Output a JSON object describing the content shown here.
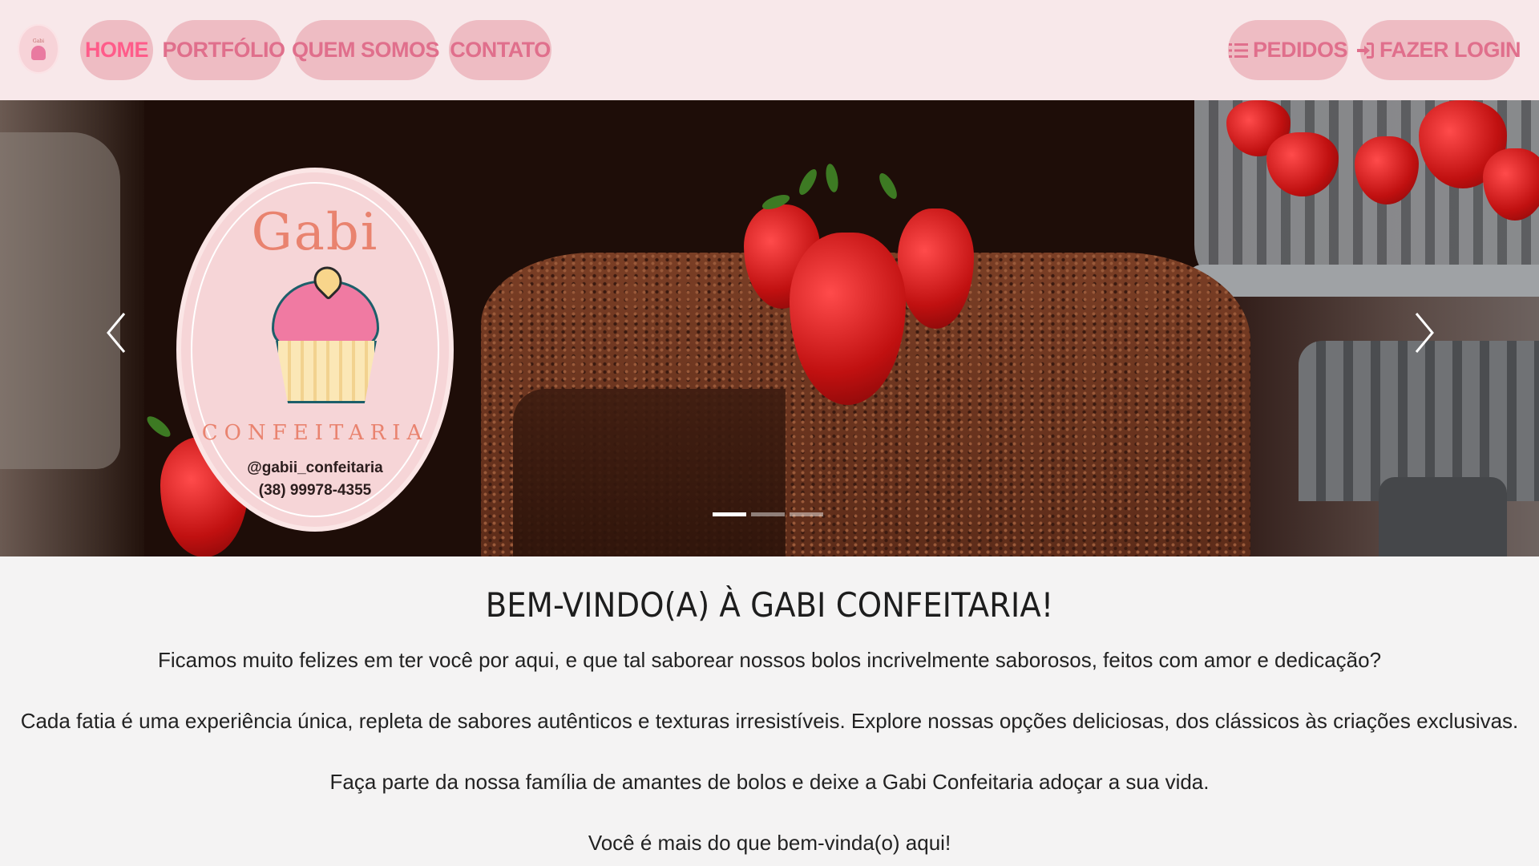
{
  "nav": {
    "logo_alt": "Gabi Confeitaria",
    "links": [
      {
        "label": "HOME",
        "active": true
      },
      {
        "label": "PORTFÓLIO",
        "active": false
      },
      {
        "label": "QUEM SOMOS",
        "active": false
      },
      {
        "label": "CONTATO",
        "active": false
      }
    ],
    "orders_label": "PEDIDOS",
    "orders_icon": "list-icon",
    "login_label": "FAZER LOGIN",
    "login_icon": "sign-in-icon"
  },
  "hero": {
    "logo_brand": "Gabi",
    "logo_subtitle": "CONFEITARIA",
    "logo_handle": "@gabii_confeitaria",
    "logo_phone": "(38) 99978-4355",
    "slides_total": 3,
    "active_slide": 1
  },
  "content": {
    "title": "BEM-VINDO(A) À GABI CONFEITARIA!",
    "paragraphs": [
      "Ficamos muito felizes em ter você por aqui, e que tal saborear nossos bolos incrivelmente saborosos, feitos com amor e dedicação?",
      "Cada fatia é uma experiência única, repleta de sabores autênticos e texturas irresistíveis. Explore nossas opções deliciosas, dos clássicos às criações exclusivas.",
      "Faça parte da nossa família de amantes de bolos e deixe a Gabi Confeitaria adoçar a sua vida.",
      "Você é mais do que bem-vinda(o) aqui!"
    ]
  },
  "colors": {
    "navbar_bg": "#f8e8ea",
    "pill_bg": "#eebcc3",
    "pill_text": "#e06f8c",
    "active_text": "#ff5c8a",
    "page_bg": "#f4f3f3"
  }
}
